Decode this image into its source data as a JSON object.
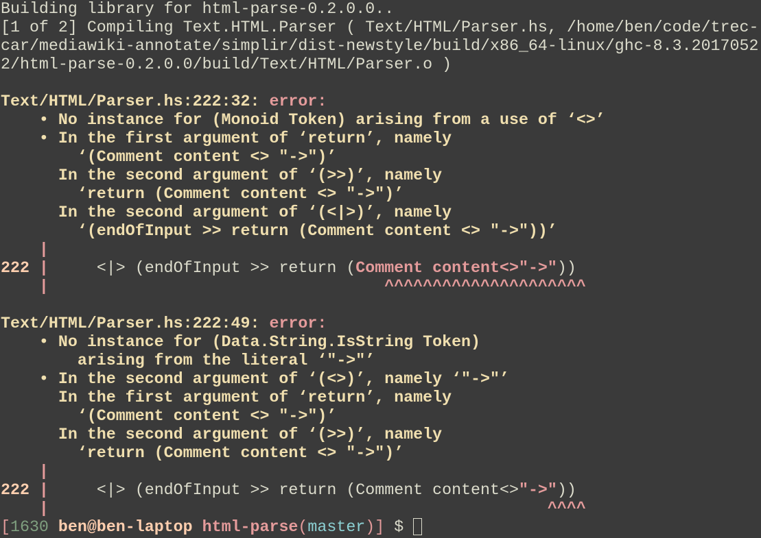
{
  "build": {
    "line1": "Building library for html-parse-0.2.0.0..",
    "line2": "[1 of 2] Compiling Text.HTML.Parser ( Text/HTML/Parser.hs, /home/ben/code/trec-",
    "line3": "car/mediawiki-annotate/simplir/dist-newstyle/build/x86_64-linux/ghc-8.3.2017052",
    "line4": "2/html-parse-0.2.0.0/build/Text/HTML/Parser.o )"
  },
  "error1": {
    "location": "Text/HTML/Parser.hs:222:32:",
    "label": "error:",
    "lines": [
      "    • No instance for (Monoid Token) arising from a use of ‘<>’",
      "    • In the first argument of ‘return’, namely",
      "        ‘(Comment content <> \"->\")’",
      "      In the second argument of ‘(>>)’, namely",
      "        ‘return (Comment content <> \"->\")’",
      "      In the second argument of ‘(<|>)’, namely",
      "        ‘(endOfInput >> return (Comment content <> \"->\"))’"
    ],
    "gutter_top": "    |",
    "line_no": "222",
    "gutter_bar": " |",
    "code_prefix": "     <|> (endOfInput >> return (",
    "code_highlight": "Comment content<>\"->\"",
    "code_suffix": "))",
    "gutter_bottom": "    |",
    "caret_pad": "                                   ",
    "caret": "^^^^^^^^^^^^^^^^^^^^^"
  },
  "error2": {
    "location": "Text/HTML/Parser.hs:222:49:",
    "label": "error:",
    "lines": [
      "    • No instance for (Data.String.IsString Token)",
      "        arising from the literal ‘\"->\"’",
      "    • In the second argument of ‘(<>)’, namely ‘\"->\"’",
      "      In the first argument of ‘return’, namely",
      "        ‘(Comment content <> \"->\")’",
      "      In the second argument of ‘(>>)’, namely",
      "        ‘return (Comment content <> \"->\")’"
    ],
    "gutter_top": "    |",
    "line_no": "222",
    "gutter_bar": " |",
    "code_prefix": "     <|> (endOfInput >> return (Comment content<>",
    "code_highlight": "\"->\"",
    "code_suffix": "))",
    "gutter_bottom": "    |",
    "caret_pad": "                                                    ",
    "caret": "^^^^"
  },
  "prompt": {
    "open": "[",
    "count": "1630",
    "user_host": "ben@ben-laptop",
    "dir": "html-parse",
    "branch_open": "(",
    "branch": "master",
    "branch_close": ")",
    "close": "]",
    "symbol": "$"
  },
  "colors": {
    "background": "#3a3a3a",
    "text": "#dcdccc",
    "message": "#f0dfaf",
    "error": "#e49b9b",
    "count": "#7f9f7f",
    "branch": "#8cd0d3"
  }
}
